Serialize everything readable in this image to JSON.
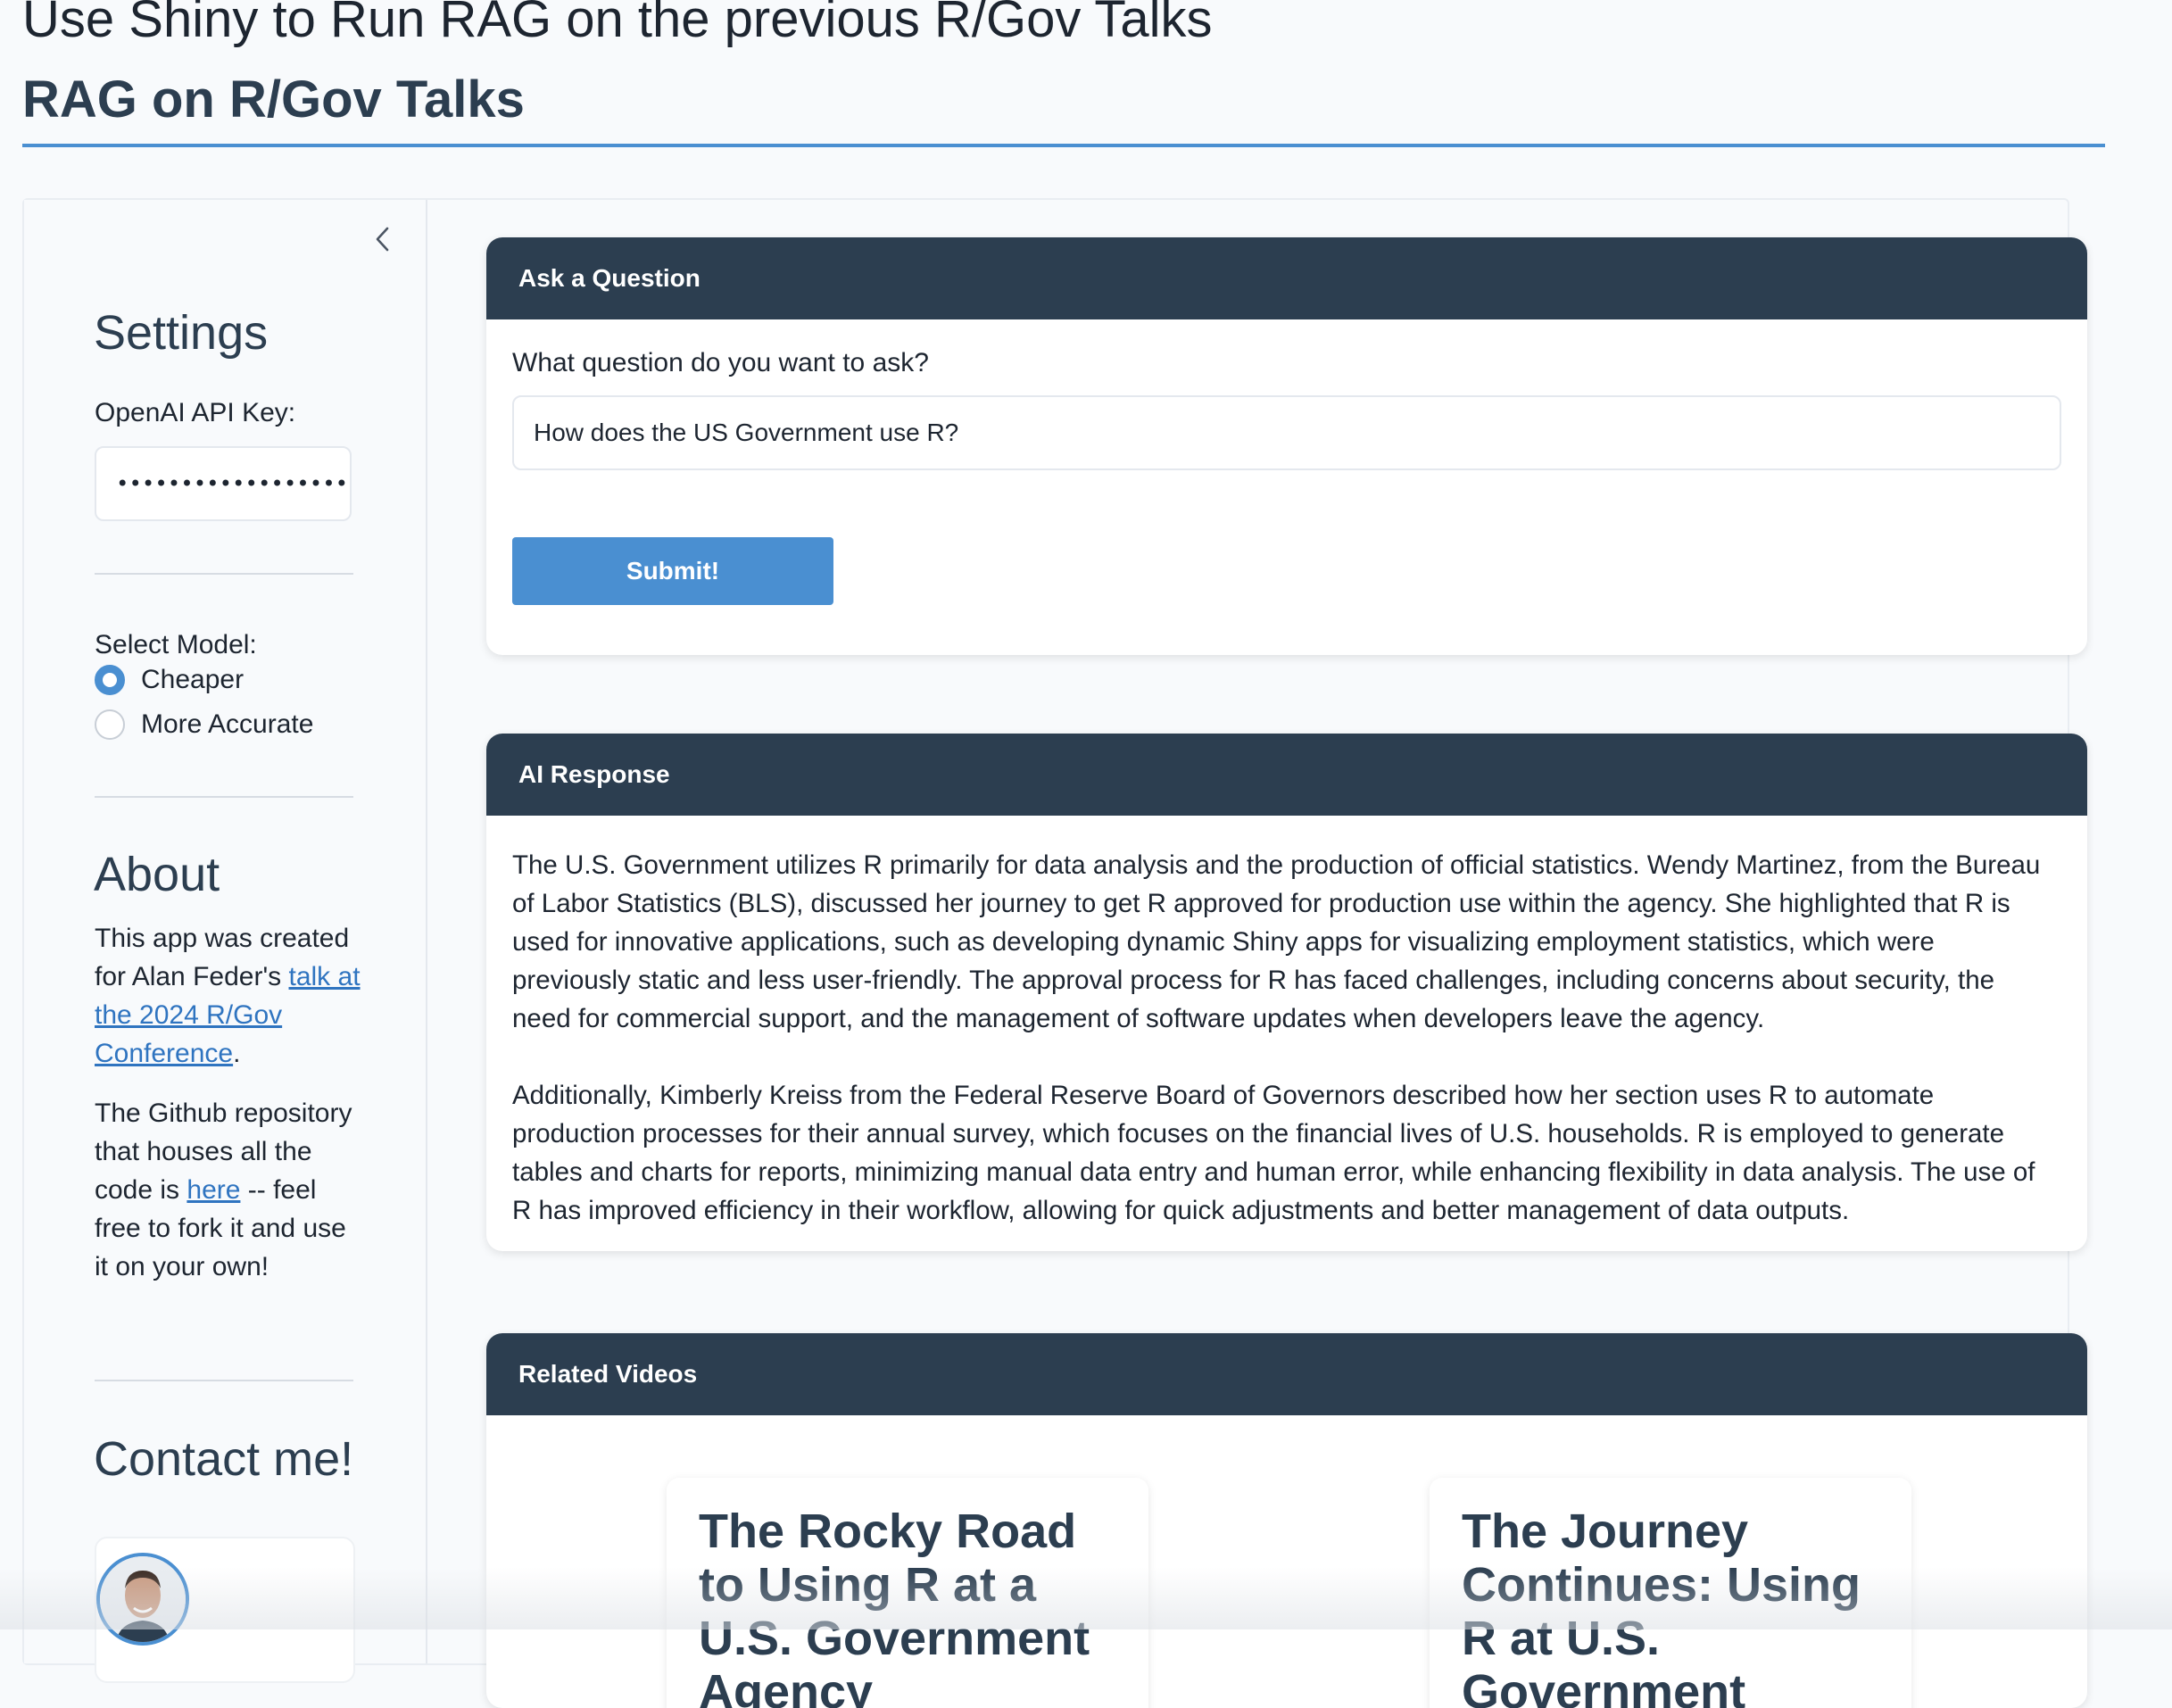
{
  "header": {
    "title": "Use Shiny to Run RAG on the previous R/Gov Talks",
    "subtitle": "RAG on R/Gov Talks"
  },
  "sidebar": {
    "collapse_icon": "chevron-left-icon",
    "settings_heading": "Settings",
    "api_key_label": "OpenAI API Key:",
    "api_key_value": "•••••••••••••••••••••••",
    "model_label": "Select Model:",
    "model_options": [
      {
        "label": "Cheaper",
        "checked": true
      },
      {
        "label": "More Accurate",
        "checked": false
      }
    ],
    "about_heading": "About",
    "about_p1_pre": "This app was created for Alan Feder's ",
    "about_p1_link": "talk at the 2024 R/Gov Conference",
    "about_p1_post": ".",
    "about_p2_pre": "The Github repository that houses all the code is ",
    "about_p2_link": "here",
    "about_p2_post": " -- feel free to fork it and use it on your own!",
    "contact_heading": "Contact me!"
  },
  "question_card": {
    "header": "Ask a Question",
    "label": "What question do you want to ask?",
    "input_value": "How does the US Government use R?",
    "submit_label": "Submit!"
  },
  "response_card": {
    "header": "AI Response",
    "paragraphs": [
      "The U.S. Government utilizes R primarily for data analysis and the production of official statistics. Wendy Martinez, from the Bureau of Labor Statistics (BLS), discussed her journey to get R approved for production use within the agency. She highlighted that R is used for innovative applications, such as developing dynamic Shiny apps for visualizing employment statistics, which were previously static and less user-friendly. The approval process for R has faced challenges, including concerns about security, the need for commercial support, and the management of software updates when developers leave the agency.",
      "Additionally, Kimberly Kreiss from the Federal Reserve Board of Governors described how her section uses R to automate production processes for their annual survey, which focuses on the financial lives of U.S. households. R is employed to generate tables and charts for reports, minimizing manual data entry and human error, while enhancing flexibility in data analysis. The use of R has improved efficiency in their workflow, allowing for quick adjustments and better management of data outputs."
    ]
  },
  "videos_card": {
    "header": "Related Videos",
    "videos": [
      {
        "title": "The Rocky Road to Using R at a U.S. Government Agency"
      },
      {
        "title": "The Journey Continues: Using R at U.S. Government Agencies"
      }
    ]
  },
  "colors": {
    "accent": "#4a8fd1",
    "card_header": "#2c3e50",
    "background": "#f8fafc"
  }
}
